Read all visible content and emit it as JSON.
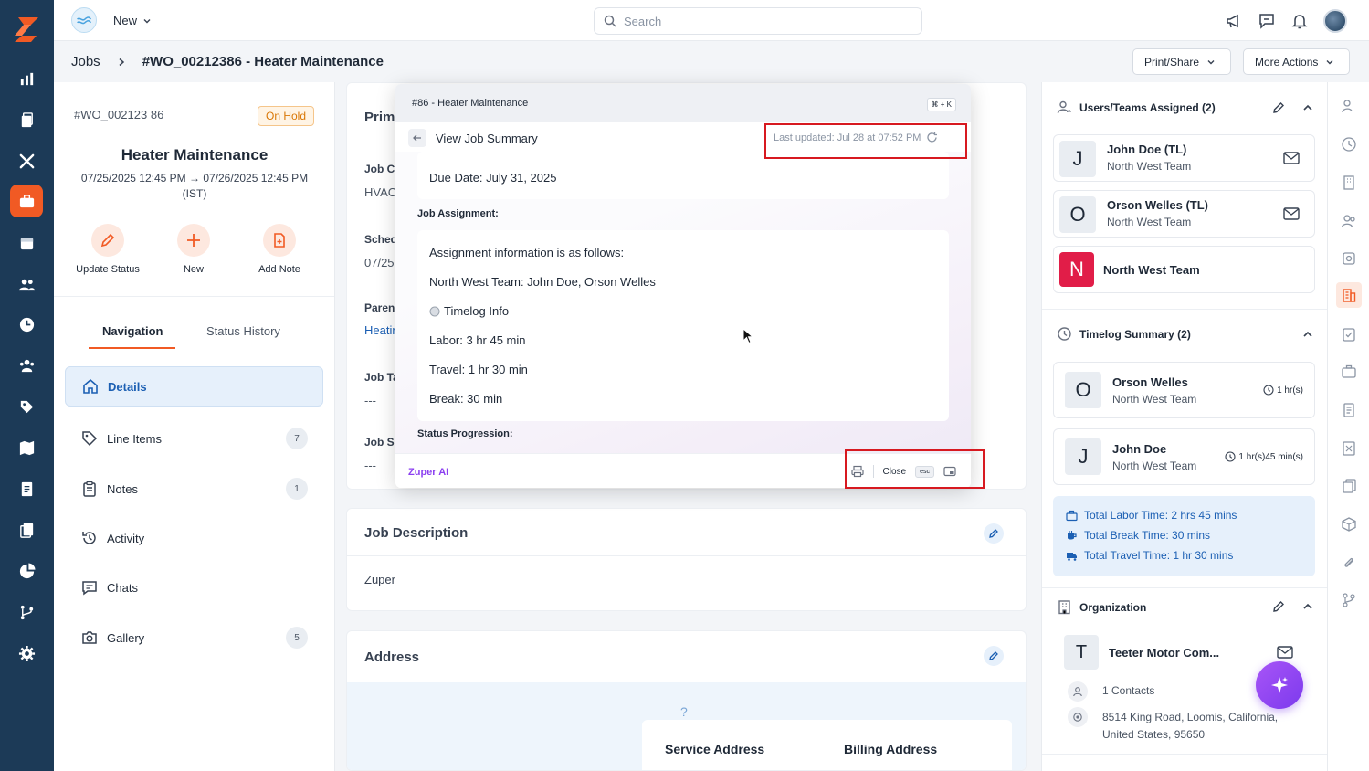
{
  "topbar": {
    "new_label": "New",
    "search_placeholder": "Search"
  },
  "breadcrumb": {
    "root": "Jobs",
    "current": "#WO_00212386 - Heater Maintenance"
  },
  "header_actions": {
    "print_share": "Print/Share",
    "more_actions": "More Actions"
  },
  "job": {
    "number": "#WO_002123 86",
    "status": "On Hold",
    "title": "Heater Maintenance",
    "dates": "07/25/2025 12:45 PM → 07/26/2025 12:45 PM",
    "timezone": "(IST)"
  },
  "quick_actions": [
    {
      "label": "Update Status",
      "icon": "pencil-icon"
    },
    {
      "label": "New",
      "icon": "plus-icon"
    },
    {
      "label": "Add Note",
      "icon": "note-add-icon"
    }
  ],
  "left_tabs": {
    "navigation": "Navigation",
    "status_history": "Status History"
  },
  "nav_items": [
    {
      "label": "Details",
      "icon": "home-icon",
      "count": ""
    },
    {
      "label": "Line Items",
      "icon": "tag-icon",
      "count": "7"
    },
    {
      "label": "Notes",
      "icon": "clipboard-icon",
      "count": "1"
    },
    {
      "label": "Activity",
      "icon": "history-icon",
      "count": ""
    },
    {
      "label": "Chats",
      "icon": "chat-icon",
      "count": ""
    },
    {
      "label": "Gallery",
      "icon": "camera-icon",
      "count": "5"
    }
  ],
  "primary_card": {
    "title": "Prima",
    "fields": [
      {
        "label": "Job Ca",
        "value": "HVAC"
      },
      {
        "label": "Sched",
        "value": "07/25"
      },
      {
        "label": "Parent",
        "value": "Heatir"
      },
      {
        "label": "Job Ta",
        "value": "---"
      },
      {
        "label": "Job Sk",
        "value": "---"
      }
    ]
  },
  "job_description": {
    "title": "Job Description",
    "text": "Zuper"
  },
  "address": {
    "title": "Address",
    "service": "Service Address",
    "billing": "Billing Address",
    "map_glyph": "?"
  },
  "modal": {
    "window_title": "#86 - Heater Maintenance",
    "shortcut": "⌘ + K",
    "subtitle": "View Job Summary",
    "last_updated": "Last updated: Jul 28 at 07:52 PM",
    "due_date": "Due Date: July 31, 2025",
    "job_assignment_heading": "Job Assignment:",
    "assignment_intro": "Assignment information is as follows:",
    "assignment_team": "North West Team: John Doe, Orson Welles",
    "timelog_info": "Timelog Info",
    "labor": "Labor: 3 hr 45 min",
    "travel": "Travel: 1 hr 30 min",
    "break": "Break: 30 min",
    "status_heading": "Status Progression:",
    "footer_brand": "Zuper AI",
    "close_label": "Close",
    "esc_label": "esc"
  },
  "users_section": {
    "title": "Users/Teams Assigned (2)",
    "users": [
      {
        "initial": "J",
        "name": "John Doe (TL)",
        "team": "North West Team"
      },
      {
        "initial": "O",
        "name": "Orson Welles (TL)",
        "team": "North West Team"
      }
    ],
    "team": {
      "initial": "N",
      "name": "North West Team",
      "color": "#e11d48"
    }
  },
  "timelog_section": {
    "title": "Timelog Summary (2)",
    "entries": [
      {
        "initial": "O",
        "name": "Orson Welles",
        "team": "North West Team",
        "duration": "1 hr(s)"
      },
      {
        "initial": "J",
        "name": "John Doe",
        "team": "North West Team",
        "duration": "1 hr(s)45 min(s)"
      }
    ],
    "totals": [
      {
        "label": "Total Labor Time: 2 hrs 45 mins",
        "icon": "briefcase-icon"
      },
      {
        "label": "Total Break Time: 30 mins",
        "icon": "coffee-icon"
      },
      {
        "label": "Total Travel Time: 1 hr 30 mins",
        "icon": "truck-icon"
      }
    ]
  },
  "organization": {
    "title": "Organization",
    "initial": "T",
    "name": "Teeter Motor Com...",
    "contacts": "1 Contacts",
    "address_line1": "8514 King Road, Loomis, California,",
    "address_line2": "United States, 95650"
  },
  "colors": {
    "accent": "#f15a24",
    "sidebar": "#1c3a57",
    "link": "#1b5fb3",
    "ai": "#8b3ff0",
    "highlight": "#d71920"
  }
}
